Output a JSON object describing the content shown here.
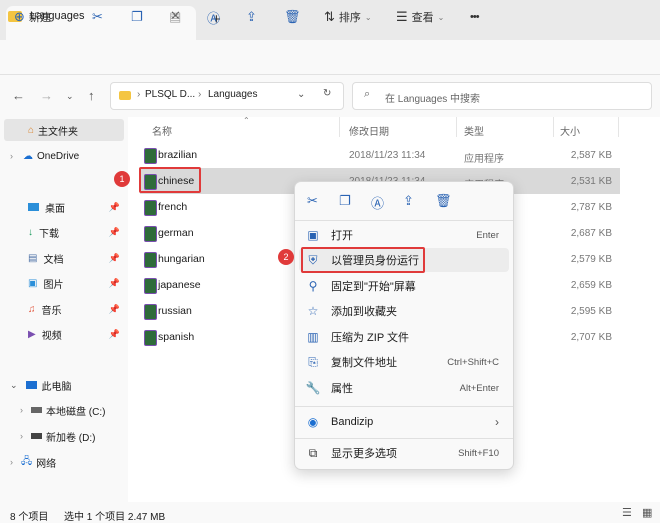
{
  "window": {
    "tab_title": "Languages",
    "close_glyph": "✕",
    "new_tab_glyph": "+"
  },
  "toolbar": {
    "new_label": "新建",
    "sort_label": "排序",
    "view_label": "查看",
    "more_glyph": "•••"
  },
  "address": {
    "crumb1": "PLSQL D...",
    "crumb2": "Languages",
    "search_placeholder": "在 Languages 中搜索"
  },
  "sidebar": {
    "home": "主文件夹",
    "onedrive": "OneDrive",
    "quick": [
      "桌面",
      "下载",
      "文档",
      "图片",
      "音乐",
      "视频"
    ],
    "thispc": "此电脑",
    "drives": [
      "本地磁盘 (C:)",
      "新加卷 (D:)"
    ],
    "network": "网络"
  },
  "columns": {
    "name": "名称",
    "date": "修改日期",
    "type": "类型",
    "size": "大小"
  },
  "files": [
    {
      "name": "brazilian",
      "date": "2018/11/23 11:34",
      "type": "应用程序",
      "size": "2,587 KB"
    },
    {
      "name": "chinese",
      "date": "2018/11/23 11:34",
      "type": "应用程序",
      "size": "2,531 KB"
    },
    {
      "name": "french",
      "date": "",
      "type": "",
      "size": "2,787 KB"
    },
    {
      "name": "german",
      "date": "",
      "type": "",
      "size": "2,687 KB"
    },
    {
      "name": "hungarian",
      "date": "",
      "type": "",
      "size": "2,579 KB"
    },
    {
      "name": "japanese",
      "date": "",
      "type": "",
      "size": "2,659 KB"
    },
    {
      "name": "russian",
      "date": "",
      "type": "",
      "size": "2,595 KB"
    },
    {
      "name": "spanish",
      "date": "",
      "type": "",
      "size": "2,707 KB"
    }
  ],
  "status": {
    "count": "8 个项目",
    "selection": "选中 1 个项目  2.47 MB"
  },
  "context_menu": {
    "open": {
      "label": "打开",
      "shortcut": "Enter"
    },
    "run_as_admin": {
      "label": "以管理员身份运行"
    },
    "pin_start": {
      "label": "固定到\"开始\"屏幕"
    },
    "add_favorites": {
      "label": "添加到收藏夹"
    },
    "compress_zip": {
      "label": "压缩为 ZIP 文件"
    },
    "copy_path": {
      "label": "复制文件地址",
      "shortcut": "Ctrl+Shift+C"
    },
    "properties": {
      "label": "属性",
      "shortcut": "Alt+Enter"
    },
    "bandizip": {
      "label": "Bandizip",
      "arrow": "›"
    },
    "more_options": {
      "label": "显示更多选项",
      "shortcut": "Shift+F10"
    }
  },
  "annotations": {
    "step1": "1",
    "step2": "2"
  }
}
